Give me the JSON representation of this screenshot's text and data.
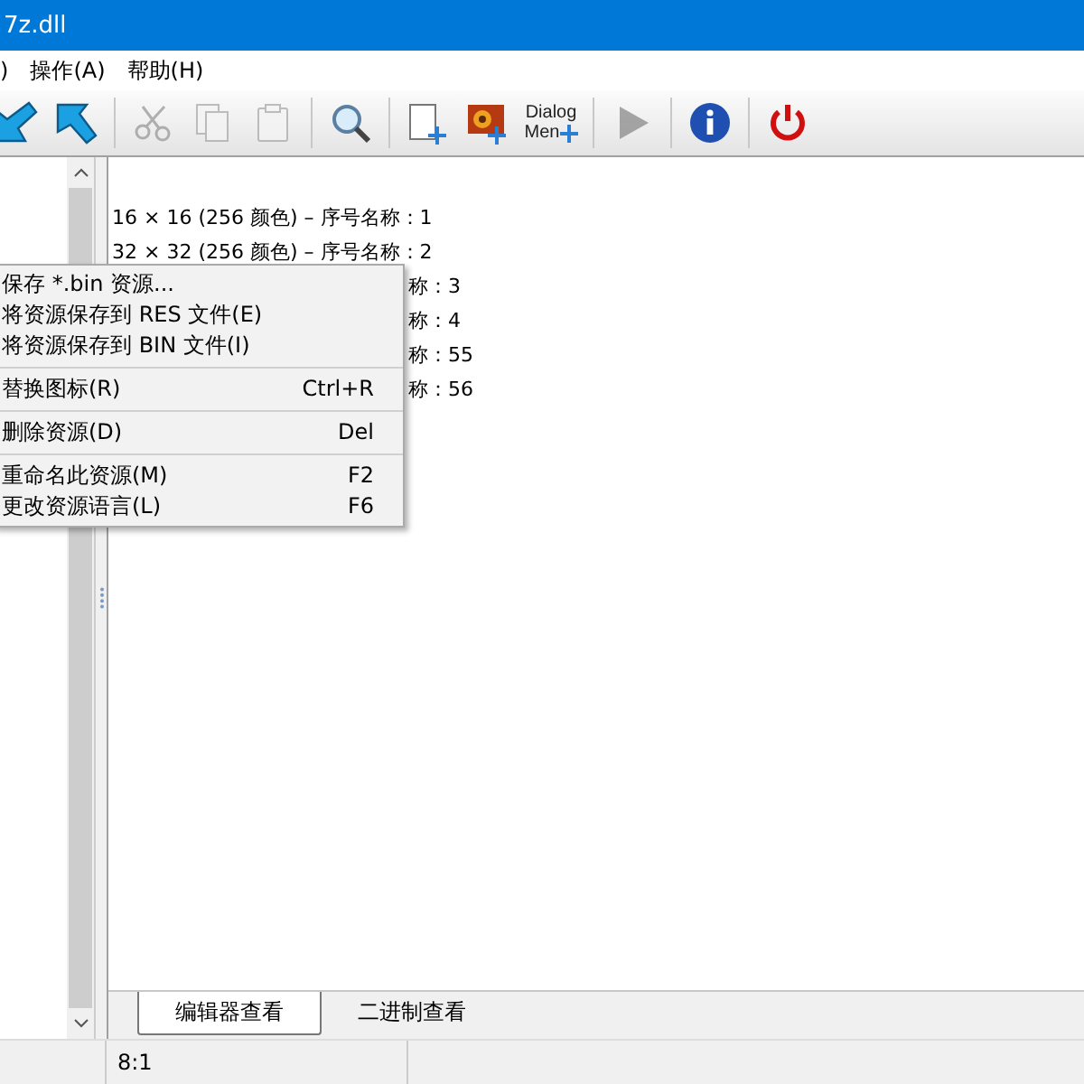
{
  "window": {
    "title": "7z.dll"
  },
  "menu_bar": [
    {
      "label": ")"
    },
    {
      "label": "操作(A)"
    },
    {
      "label": "帮助(H)"
    }
  ],
  "toolbar": [
    {
      "kind": "arrow-left"
    },
    {
      "kind": "arrow-right"
    },
    {
      "kind": "sep"
    },
    {
      "kind": "cut",
      "disabled": true
    },
    {
      "kind": "copy",
      "disabled": true
    },
    {
      "kind": "paste",
      "disabled": true
    },
    {
      "kind": "sep"
    },
    {
      "kind": "find",
      "disabled": false
    },
    {
      "kind": "sep"
    },
    {
      "kind": "new"
    },
    {
      "kind": "image"
    },
    {
      "kind": "dialog",
      "line1": "Dialog",
      "line2": "Men"
    },
    {
      "kind": "sep"
    },
    {
      "kind": "play",
      "disabled": true
    },
    {
      "kind": "sep"
    },
    {
      "kind": "info"
    },
    {
      "kind": "sep"
    },
    {
      "kind": "power"
    }
  ],
  "content_lines": [
    {
      "kind": "full",
      "text": "16 × 16 (256 颜色) – 序号名称：1"
    },
    {
      "kind": "full",
      "text": "32 × 32 (256 颜色) – 序号名称：2"
    },
    {
      "kind": "tail",
      "text": "称：3"
    },
    {
      "kind": "tail",
      "text": "称：4"
    },
    {
      "kind": "tail",
      "text": "称：55"
    },
    {
      "kind": "tail",
      "text": "称：56"
    }
  ],
  "context_menu": [
    {
      "kind": "item",
      "label": "保存 *.bin 资源..."
    },
    {
      "kind": "item",
      "label": "将资源保存到 RES 文件(E)"
    },
    {
      "kind": "item",
      "label": "将资源保存到 BIN 文件(I)"
    },
    {
      "kind": "separator"
    },
    {
      "kind": "item",
      "label": "替换图标(R)",
      "shortcut": "Ctrl+R"
    },
    {
      "kind": "separator"
    },
    {
      "kind": "item",
      "label": "删除资源(D)",
      "shortcut": "Del"
    },
    {
      "kind": "separator"
    },
    {
      "kind": "item",
      "label": "重命名此资源(M)",
      "shortcut": "F2"
    },
    {
      "kind": "item",
      "label": "更改资源语言(L)",
      "shortcut": "F6"
    }
  ],
  "tabs": [
    {
      "label": "编辑器查看",
      "selected": true
    },
    {
      "label": "二进制查看",
      "selected": false
    }
  ],
  "status_bar": {
    "position": "8:1"
  }
}
